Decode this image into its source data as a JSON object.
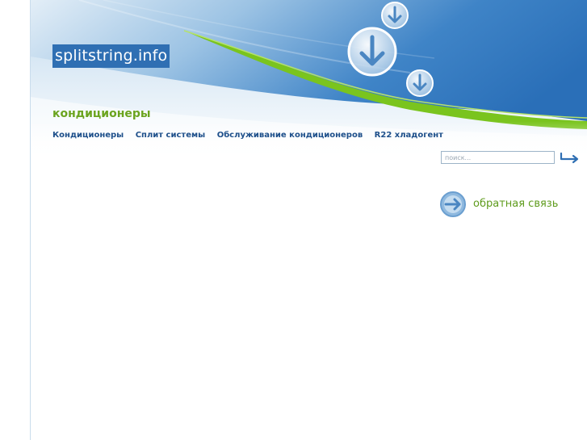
{
  "site": {
    "logo_text": "splitstring.info",
    "subtitle": "кондиционеры"
  },
  "nav": {
    "items": [
      {
        "label": "Кондиционеры"
      },
      {
        "label": "Сплит системы"
      },
      {
        "label": "Обслуживание кондиционеров"
      },
      {
        "label": "R22 хладогент"
      }
    ]
  },
  "search": {
    "placeholder": "поиск...",
    "value": ""
  },
  "feedback": {
    "label": "обратная связь"
  },
  "colors": {
    "header_blue": "#2f6fb3",
    "accent_green": "#7ac41e",
    "nav_text": "#1d4f8a"
  },
  "icons": {
    "header_arrows": "download-arrow-icon",
    "search_submit": "return-arrow-icon",
    "feedback": "right-arrow-circle-icon"
  }
}
